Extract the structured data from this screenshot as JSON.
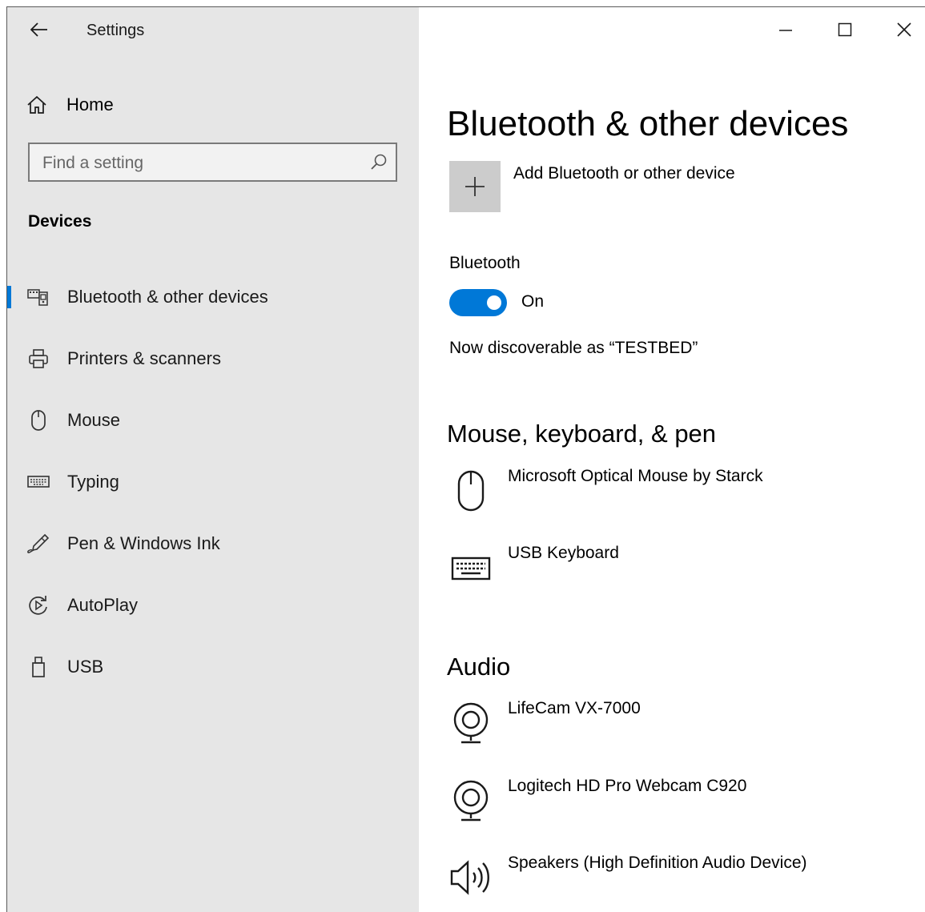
{
  "window": {
    "app_title": "Settings",
    "controls": {
      "minimize_icon": "minimize-icon",
      "maximize_icon": "maximize-icon",
      "close_icon": "close-icon"
    }
  },
  "sidebar": {
    "home_label": "Home",
    "search_placeholder": "Find a setting",
    "section_label": "Devices",
    "items": [
      {
        "label": "Bluetooth & other devices",
        "icon": "bluetooth-devices-icon",
        "active": true
      },
      {
        "label": "Printers & scanners",
        "icon": "printer-icon",
        "active": false
      },
      {
        "label": "Mouse",
        "icon": "mouse-icon",
        "active": false
      },
      {
        "label": "Typing",
        "icon": "keyboard-icon",
        "active": false
      },
      {
        "label": "Pen & Windows Ink",
        "icon": "pen-icon",
        "active": false
      },
      {
        "label": "AutoPlay",
        "icon": "autoplay-icon",
        "active": false
      },
      {
        "label": "USB",
        "icon": "usb-icon",
        "active": false
      }
    ]
  },
  "main": {
    "title": "Bluetooth & other devices",
    "add_device_label": "Add Bluetooth or other device",
    "bluetooth_label": "Bluetooth",
    "bluetooth_state": "On",
    "bluetooth_on": true,
    "discoverable_text": "Now discoverable as “TESTBED”",
    "groups": [
      {
        "heading": "Mouse, keyboard, & pen",
        "devices": [
          {
            "name": "Microsoft Optical Mouse by Starck",
            "icon": "mouse-icon"
          },
          {
            "name": "USB Keyboard",
            "icon": "keyboard-icon"
          }
        ]
      },
      {
        "heading": "Audio",
        "devices": [
          {
            "name": "LifeCam VX-7000",
            "icon": "webcam-icon"
          },
          {
            "name": "Logitech HD Pro Webcam C920",
            "icon": "webcam-icon"
          },
          {
            "name": "Speakers (High Definition Audio Device)",
            "icon": "speaker-icon"
          }
        ]
      }
    ]
  },
  "colors": {
    "accent": "#0078d7",
    "sidebar_bg": "#e6e6e6",
    "tile_bg": "#cccccc"
  }
}
